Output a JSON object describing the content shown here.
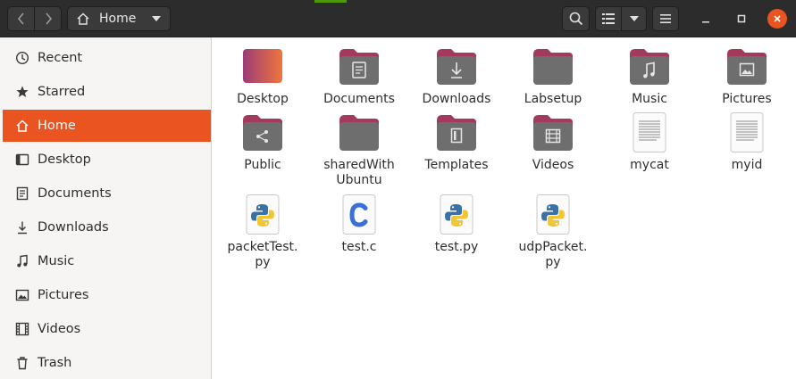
{
  "header": {
    "path": {
      "label": "Home",
      "icon": "home-icon"
    },
    "buttons": {
      "back": "go-back-icon",
      "forward": "go-forward-icon",
      "search": "search-icon",
      "view_list": "list-view-icon",
      "view_options": "chevron-down-icon",
      "menu": "hamburger-menu-icon",
      "minimize": "minimize-icon",
      "maximize": "maximize-icon",
      "close": "close-icon"
    },
    "colors": {
      "background": "#2c2c2c",
      "close_button": "#e95420"
    }
  },
  "sidebar": {
    "items": [
      {
        "label": "Recent",
        "icon": "clock-icon",
        "active": false
      },
      {
        "label": "Starred",
        "icon": "star-icon",
        "active": false
      },
      {
        "label": "Home",
        "icon": "home-icon",
        "active": true
      },
      {
        "label": "Desktop",
        "icon": "desktop-icon",
        "active": false
      },
      {
        "label": "Documents",
        "icon": "document-icon",
        "active": false
      },
      {
        "label": "Downloads",
        "icon": "download-icon",
        "active": false
      },
      {
        "label": "Music",
        "icon": "music-note-icon",
        "active": false
      },
      {
        "label": "Pictures",
        "icon": "picture-icon",
        "active": false
      },
      {
        "label": "Videos",
        "icon": "film-icon",
        "active": false
      },
      {
        "label": "Trash",
        "icon": "trash-icon",
        "active": false
      }
    ],
    "colors": {
      "active": "#e95420",
      "background": "#f6f5f4"
    }
  },
  "files": [
    {
      "name": "Desktop",
      "type": "desktop-folder"
    },
    {
      "name": "Documents",
      "type": "folder",
      "emblem": "document-emblem"
    },
    {
      "name": "Downloads",
      "type": "folder",
      "emblem": "download-emblem"
    },
    {
      "name": "Labsetup",
      "type": "folder",
      "emblem": ""
    },
    {
      "name": "Music",
      "type": "folder",
      "emblem": "music-emblem"
    },
    {
      "name": "Pictures",
      "type": "folder",
      "emblem": "picture-emblem"
    },
    {
      "name": "Public",
      "type": "folder",
      "emblem": "share-emblem"
    },
    {
      "name": "sharedWith\nUbuntu",
      "type": "folder",
      "emblem": ""
    },
    {
      "name": "Templates",
      "type": "folder",
      "emblem": "template-emblem"
    },
    {
      "name": "Videos",
      "type": "folder",
      "emblem": "film-emblem"
    },
    {
      "name": "mycat",
      "type": "text-file"
    },
    {
      "name": "myid",
      "type": "text-file"
    },
    {
      "name": "packetTest.\npy",
      "type": "python-file"
    },
    {
      "name": "test.c",
      "type": "c-file"
    },
    {
      "name": "test.py",
      "type": "python-file"
    },
    {
      "name": "udpPacket.\npy",
      "type": "python-file"
    }
  ],
  "colors": {
    "folder_body": "#6e6e6e",
    "folder_tab": "#a3395b",
    "desktop_gradient_start": "#9b3b78",
    "desktop_gradient_end": "#f0763d",
    "c_letter": "#3b6fd8"
  }
}
